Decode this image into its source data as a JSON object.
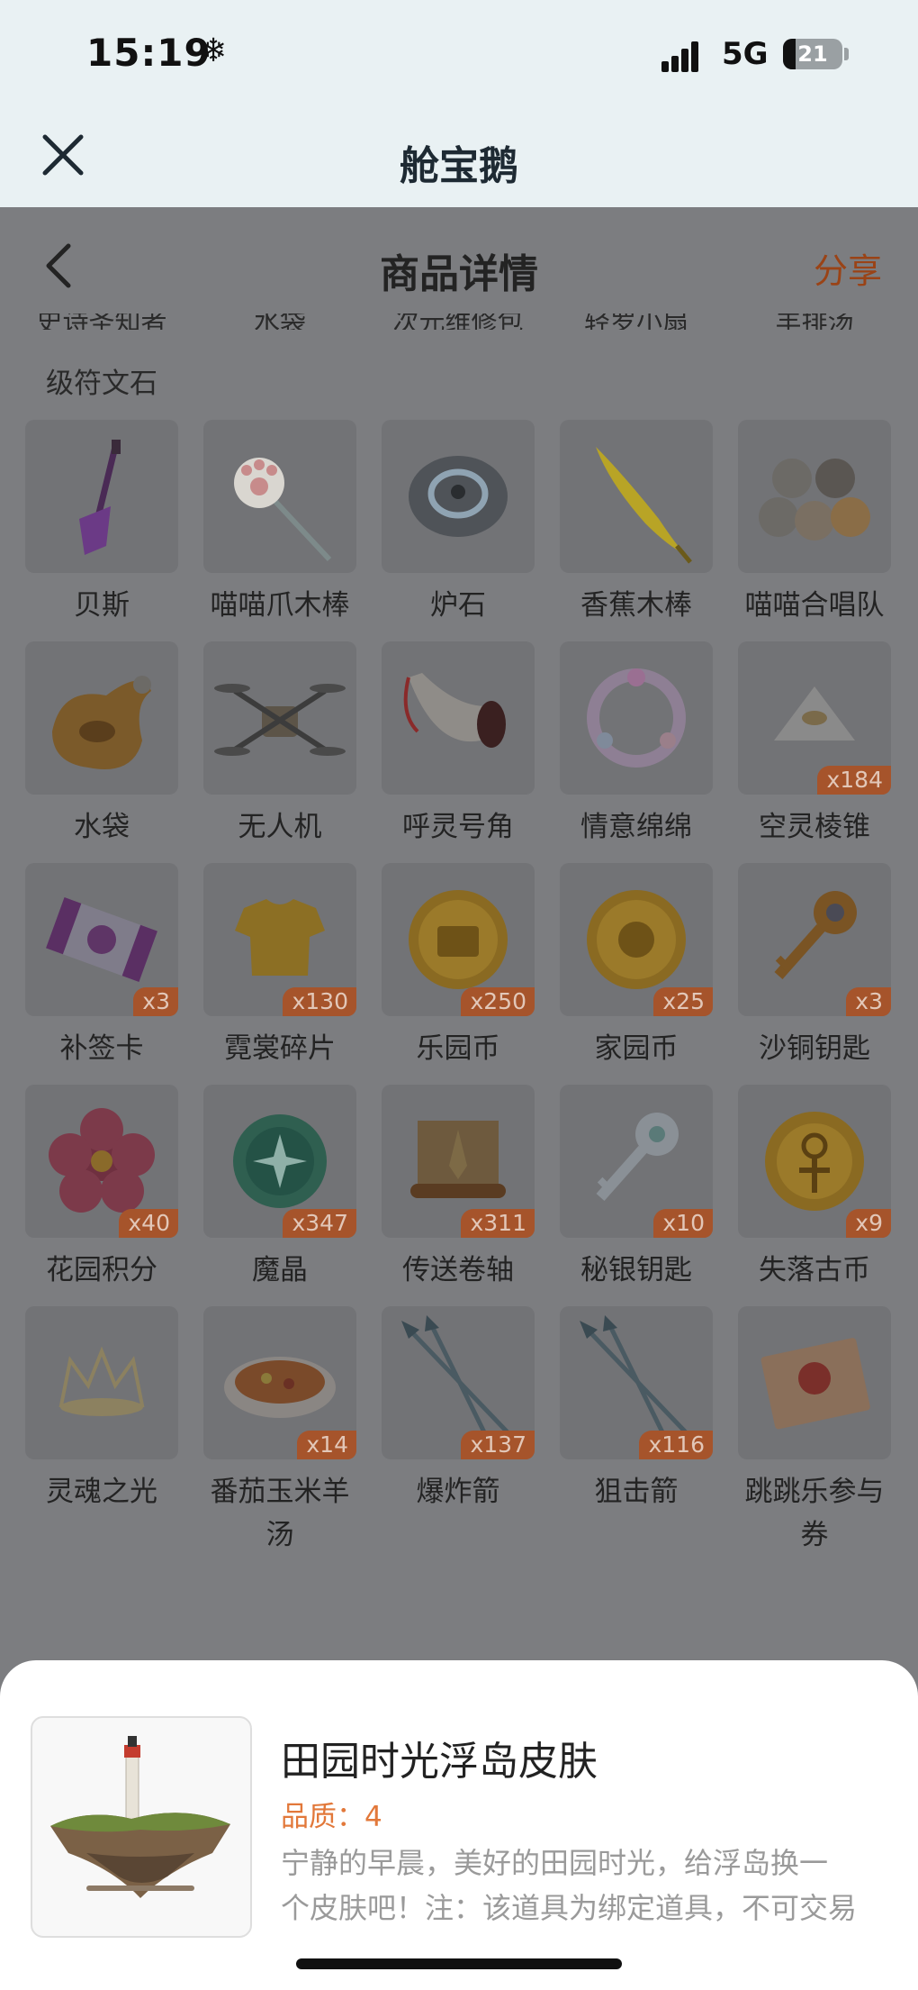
{
  "status_bar": {
    "time": "15:19",
    "network": "5G",
    "battery_level": "21"
  },
  "app_header": {
    "title": "舱宝鹅"
  },
  "page_nav": {
    "title": "商品详情",
    "share_label": "分享"
  },
  "partial_row": {
    "names": [
      "史诗圣知者",
      "水袋",
      "次元维修包",
      "轻罗小扇",
      "羊排汤"
    ],
    "first_second_line": "级符文石"
  },
  "items": [
    {
      "name": "贝斯",
      "badge": "",
      "icon": "bass-guitar-icon"
    },
    {
      "name": "喵喵爪木棒",
      "badge": "",
      "icon": "paw-stick-icon"
    },
    {
      "name": "炉石",
      "badge": "",
      "icon": "hearthstone-icon"
    },
    {
      "name": "香蕉木棒",
      "badge": "",
      "icon": "banana-stick-icon"
    },
    {
      "name": "喵喵合唱队",
      "badge": "",
      "icon": "cat-choir-icon"
    },
    {
      "name": "水袋",
      "badge": "",
      "icon": "water-bag-icon"
    },
    {
      "name": "无人机",
      "badge": "",
      "icon": "drone-icon"
    },
    {
      "name": "呼灵号角",
      "badge": "",
      "icon": "horn-icon"
    },
    {
      "name": "情意绵绵",
      "badge": "",
      "icon": "wreath-icon"
    },
    {
      "name": "空灵棱锥",
      "badge": "x184",
      "icon": "pyramid-icon"
    },
    {
      "name": "补签卡",
      "badge": "x3",
      "icon": "ticket-icon"
    },
    {
      "name": "霓裳碎片",
      "badge": "x130",
      "icon": "shirt-icon"
    },
    {
      "name": "乐园币",
      "badge": "x250",
      "icon": "chest-coin-icon"
    },
    {
      "name": "家园币",
      "badge": "x25",
      "icon": "home-coin-icon"
    },
    {
      "name": "沙铜钥匙",
      "badge": "x3",
      "icon": "bronze-key-icon"
    },
    {
      "name": "花园积分",
      "badge": "x40",
      "icon": "flower-icon"
    },
    {
      "name": "魔晶",
      "badge": "x347",
      "icon": "magic-crystal-icon"
    },
    {
      "name": "传送卷轴",
      "badge": "x311",
      "icon": "scroll-icon"
    },
    {
      "name": "秘银钥匙",
      "badge": "x10",
      "icon": "silver-key-icon"
    },
    {
      "name": "失落古币",
      "badge": "x9",
      "icon": "ancient-coin-icon"
    },
    {
      "name": "灵魂之光",
      "badge": "",
      "icon": "crown-icon"
    },
    {
      "name": "番茄玉米羊汤",
      "badge": "x14",
      "icon": "soup-bowl-icon"
    },
    {
      "name": "爆炸箭",
      "badge": "x137",
      "icon": "arrows-icon"
    },
    {
      "name": "狙击箭",
      "badge": "x116",
      "icon": "arrows-icon"
    },
    {
      "name": "跳跳乐参与券",
      "badge": "",
      "icon": "coupon-icon"
    }
  ],
  "bottom_sheet": {
    "title": "田园时光浮岛皮肤",
    "quality": "品质：4",
    "desc_line1": "宁静的早晨，美好的田园时光，给浮岛换一",
    "desc_line2": "个皮肤吧！注：该道具为绑定道具，不可交易",
    "thumb_icon": "floating-island-icon"
  }
}
